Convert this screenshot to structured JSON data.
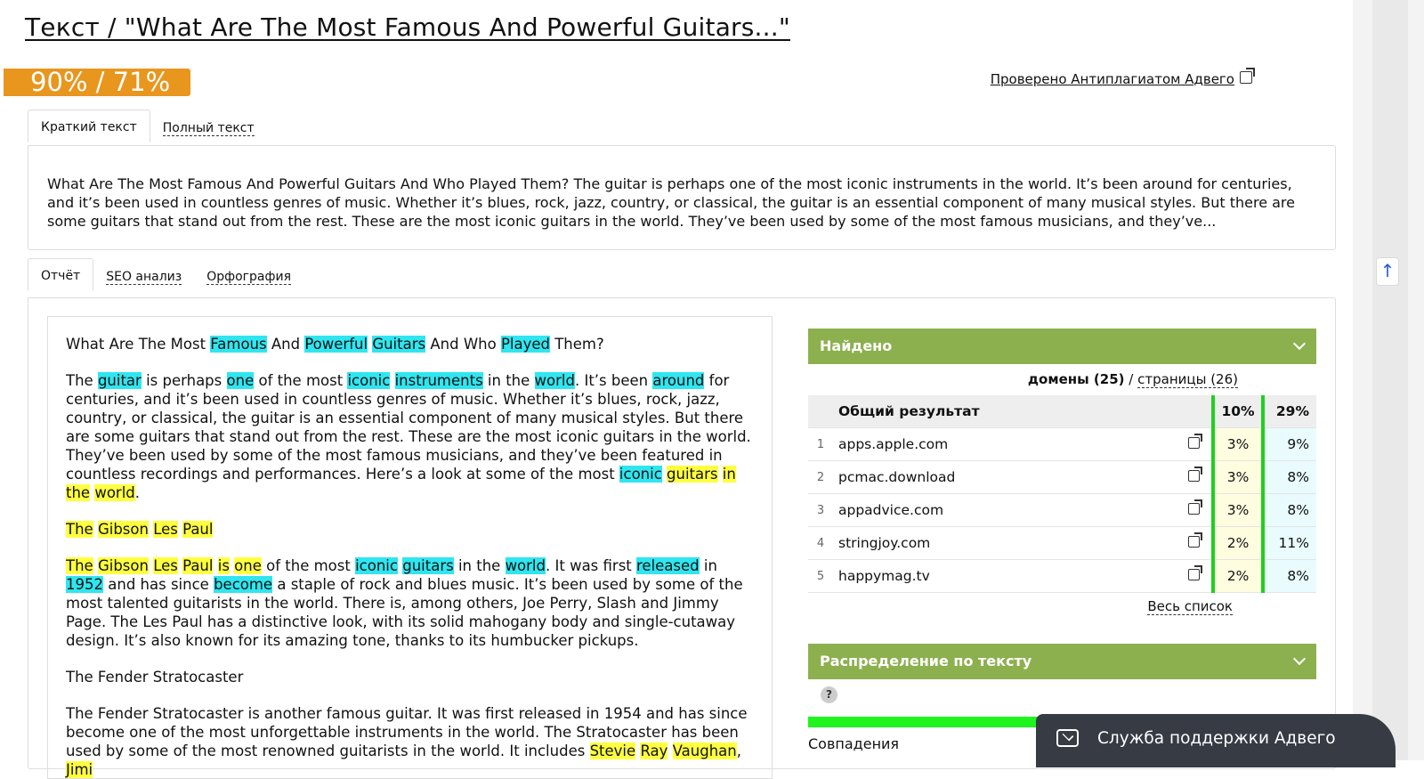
{
  "title": "Текст / \"What Are The Most Famous And Powerful Guitars...\"",
  "score": "90% / 71%",
  "checked_label": "Проверено Антиплагиатом Адвего",
  "text_tabs": [
    "Краткий текст",
    "Полный текст"
  ],
  "summary": "What Are The Most Famous And Powerful Guitars And Who Played Them? The guitar is perhaps one of the most iconic instruments in the world. It’s been around for centuries, and it’s been used in countless genres of music. Whether it’s blues, rock, jazz, country, or classical, the guitar is an essential component of many musical styles. But there are some guitars that stand out from the rest. These are the most iconic guitars in the world. They’ve been used by some of the most famous musicians, and they’ve...",
  "report_tabs": [
    "Отчёт",
    "SEO анализ",
    "Орфография"
  ],
  "report": {
    "p1": [
      {
        "t": "What Are The Most "
      },
      {
        "t": "Famous",
        "h": "c"
      },
      {
        "t": " And "
      },
      {
        "t": "Powerful",
        "h": "c"
      },
      {
        "t": " "
      },
      {
        "t": "Guitars",
        "h": "c"
      },
      {
        "t": " And Who "
      },
      {
        "t": "Played",
        "h": "c"
      },
      {
        "t": " Them?"
      }
    ],
    "p2": [
      {
        "t": "The "
      },
      {
        "t": "guitar",
        "h": "c"
      },
      {
        "t": " is perhaps "
      },
      {
        "t": "one",
        "h": "c"
      },
      {
        "t": " of the most "
      },
      {
        "t": "iconic",
        "h": "c"
      },
      {
        "t": " "
      },
      {
        "t": "instruments",
        "h": "c"
      },
      {
        "t": " in the "
      },
      {
        "t": "world",
        "h": "c"
      },
      {
        "t": ". It’s been "
      },
      {
        "t": "around",
        "h": "c"
      },
      {
        "t": " for centuries, and it’s been used in countless genres of music. Whether it’s blues, rock, jazz, country, or classical, the guitar is an essential component of many musical styles. But there are some guitars that stand out from the rest. These are the most iconic guitars in the world. They’ve been used by some of the most famous musicians, and they’ve been featured in countless recordings and performances. Here’s a look at some of the most "
      },
      {
        "t": "iconic",
        "h": "c"
      },
      {
        "t": " "
      },
      {
        "t": "guitars",
        "h": "y"
      },
      {
        "t": " "
      },
      {
        "t": "in",
        "h": "y"
      },
      {
        "t": " "
      },
      {
        "t": "the",
        "h": "y"
      },
      {
        "t": " "
      },
      {
        "t": "world",
        "h": "y"
      },
      {
        "t": "."
      }
    ],
    "p3": [
      {
        "t": "The",
        "h": "y"
      },
      {
        "t": " "
      },
      {
        "t": "Gibson",
        "h": "y"
      },
      {
        "t": " "
      },
      {
        "t": "Les",
        "h": "y"
      },
      {
        "t": " "
      },
      {
        "t": "Paul",
        "h": "y"
      }
    ],
    "p4": [
      {
        "t": " "
      },
      {
        "t": "The",
        "h": "y"
      },
      {
        "t": " "
      },
      {
        "t": "Gibson",
        "h": "y"
      },
      {
        "t": " "
      },
      {
        "t": "Les",
        "h": "y"
      },
      {
        "t": " "
      },
      {
        "t": "Paul",
        "h": "y"
      },
      {
        "t": " "
      },
      {
        "t": "is",
        "h": "y"
      },
      {
        "t": " "
      },
      {
        "t": "one",
        "h": "y"
      },
      {
        "t": " of the most "
      },
      {
        "t": "iconic",
        "h": "c"
      },
      {
        "t": " "
      },
      {
        "t": "guitars",
        "h": "c"
      },
      {
        "t": " in the "
      },
      {
        "t": "world",
        "h": "c"
      },
      {
        "t": ". It was first "
      },
      {
        "t": "released",
        "h": "c"
      },
      {
        "t": " in "
      },
      {
        "t": "1952",
        "h": "c"
      },
      {
        "t": " and has since "
      },
      {
        "t": "become",
        "h": "c"
      },
      {
        "t": " a staple of rock and blues music. It’s been used by some of the most talented guitarists in the world. There is, among others, Joe Perry, Slash and Jimmy Page. The Les Paul has a distinctive look, with its solid mahogany body and single-cutaway design. It’s also known for its amazing tone, thanks to its humbucker pickups."
      }
    ],
    "p5": [
      {
        "t": "The Fender Stratocaster"
      }
    ],
    "p6": [
      {
        "t": "The Fender Stratocaster is another famous guitar. It was first released in 1954 and has since become one of the most unforgettable instruments in the world. The Stratocaster has been used by some of the most renowned guitarists in the world. It includes "
      },
      {
        "t": "Stevie",
        "h": "y"
      },
      {
        "t": " "
      },
      {
        "t": "Ray",
        "h": "y"
      },
      {
        "t": " "
      },
      {
        "t": "Vaughan",
        "h": "y"
      },
      {
        "t": ", "
      },
      {
        "t": "Jimi",
        "h": "y"
      }
    ]
  },
  "found_panel": "Найдено",
  "domains_label": "домены (25)",
  "pages_label": "страницы (26)",
  "slash": "/",
  "results": {
    "total_label": "Общий результат",
    "total_p1": "10%",
    "total_p2": "29%",
    "rows": [
      {
        "n": "1",
        "domain": "apps.apple.com",
        "p1": "3%",
        "p2": "9%"
      },
      {
        "n": "2",
        "domain": "pcmac.download",
        "p1": "3%",
        "p2": "8%"
      },
      {
        "n": "3",
        "domain": "appadvice.com",
        "p1": "3%",
        "p2": "8%"
      },
      {
        "n": "4",
        "domain": "stringjoy.com",
        "p1": "2%",
        "p2": "11%"
      },
      {
        "n": "5",
        "domain": "happymag.tv",
        "p1": "2%",
        "p2": "8%"
      }
    ]
  },
  "full_list": "Весь список",
  "distribution_panel": "Распределение по тексту",
  "help_mark": "?",
  "matches_label": "Совпадения",
  "support_label": "Служба поддержки Адвего",
  "totop_glyph": "↑",
  "colors": {
    "score": "#e8961e",
    "panel": "#8db04f",
    "highlight_cyan": "#2fe6f0",
    "highlight_yellow": "#ffff40",
    "bar": "#1ff41f"
  }
}
